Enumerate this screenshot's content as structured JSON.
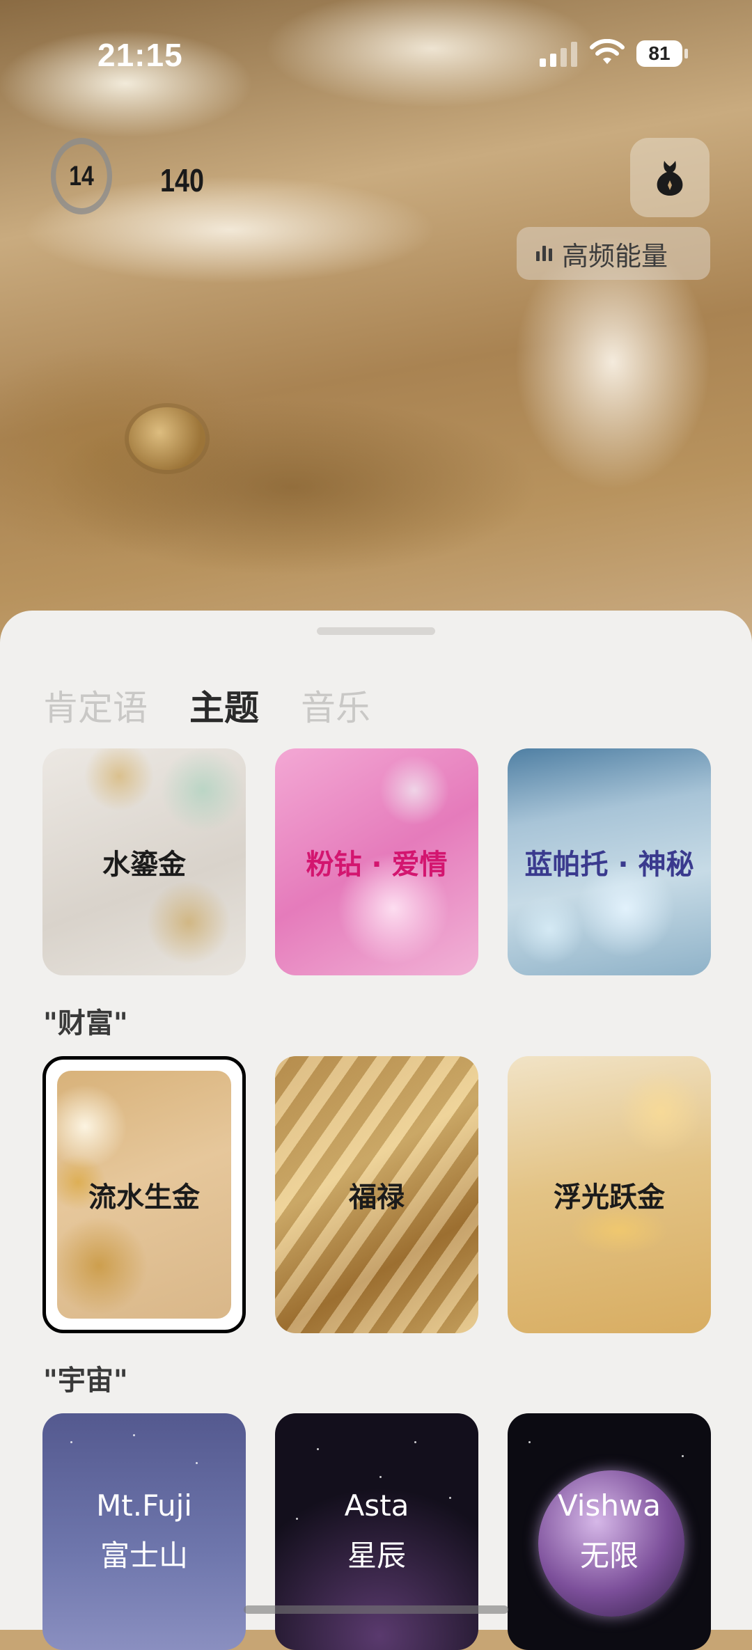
{
  "status_bar": {
    "time": "21:15",
    "battery": "81"
  },
  "header": {
    "counter_current": "14",
    "counter_total": "140",
    "profile_icon": "fox-icon",
    "energy_label": "高频能量"
  },
  "tabs": [
    {
      "label": "肯定语",
      "active": false
    },
    {
      "label": "主题",
      "active": true
    },
    {
      "label": "音乐",
      "active": false
    }
  ],
  "themes_row1": [
    {
      "label": "水鎏金"
    },
    {
      "label": "粉钻 · 爱情"
    },
    {
      "label": "蓝帕托 · 神秘"
    }
  ],
  "section_wealth": "\"财富\"",
  "wealth": [
    {
      "label": "流水生金",
      "selected": true
    },
    {
      "label": "福禄"
    },
    {
      "label": "浮光跃金"
    }
  ],
  "section_cosmos": "\"宇宙\"",
  "cosmos": [
    {
      "title": "Mt.Fuji",
      "subtitle": "富士山"
    },
    {
      "title": "Asta",
      "subtitle": "星辰"
    },
    {
      "title": "Vishwa",
      "subtitle": "无限"
    }
  ],
  "colors": {
    "pink_text": "#d3156f",
    "blue_text": "#3a3a8e",
    "sheet_bg": "#f1f0ee"
  }
}
